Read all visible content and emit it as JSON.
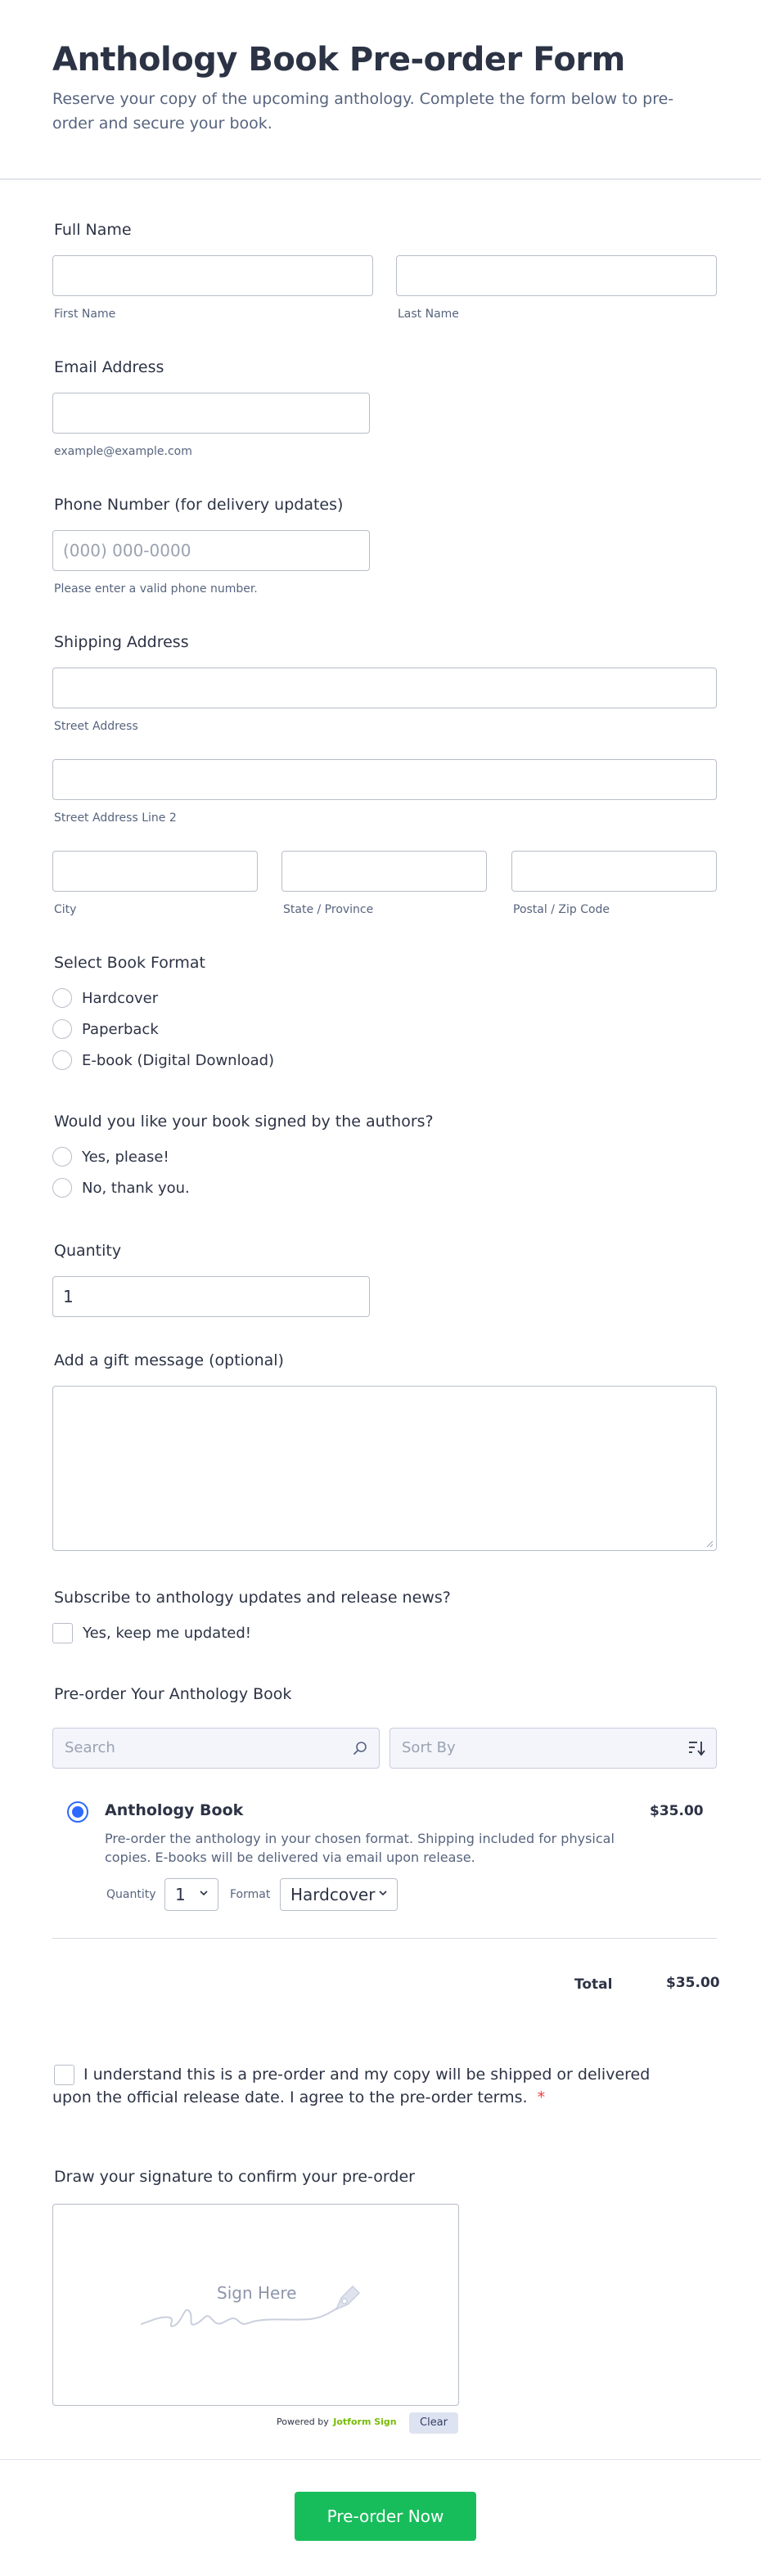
{
  "form": {
    "title": "Anthology Book Pre-order Form",
    "subtitle": "Reserve your copy of the upcoming anthology. Complete the form below to pre-order and secure your book."
  },
  "full_name": {
    "label": "Full Name",
    "first_sublabel": "First Name",
    "last_sublabel": "Last Name"
  },
  "email": {
    "label": "Email Address",
    "sublabel": "example@example.com"
  },
  "phone": {
    "label": "Phone Number (for delivery updates)",
    "placeholder": "(000) 000-0000",
    "sublabel": "Please enter a valid phone number."
  },
  "address": {
    "label": "Shipping Address",
    "street_sublabel": "Street Address",
    "street2_sublabel": "Street Address Line 2",
    "city_sublabel": "City",
    "state_sublabel": "State / Province",
    "zip_sublabel": "Postal / Zip Code"
  },
  "format": {
    "label": "Select Book Format",
    "options": [
      "Hardcover",
      "Paperback",
      "E-book (Digital Download)"
    ]
  },
  "signed": {
    "label": "Would you like your book signed by the authors?",
    "options": [
      "Yes, please!",
      "No, thank you."
    ]
  },
  "quantity": {
    "label": "Quantity",
    "value": "1"
  },
  "gift": {
    "label": "Add a gift message (optional)"
  },
  "subscribe": {
    "label": "Subscribe to anthology updates and release news?",
    "option": "Yes, keep me updated!"
  },
  "product_list": {
    "label": "Pre-order Your Anthology Book",
    "search_placeholder": "Search",
    "sort_placeholder": "Sort By",
    "product": {
      "name": "Anthology Book",
      "price": "$35.00",
      "description": "Pre-order the anthology in your chosen format. Shipping included for physical copies. E-books will be delivered via email upon release.",
      "quantity_label": "Quantity",
      "quantity_value": "1",
      "format_label": "Format",
      "format_value": "Hardcover"
    },
    "total_label": "Total",
    "total_value": "$35.00"
  },
  "terms": {
    "text": "I understand this is a pre-order and my copy will be shipped or delivered upon the official release date. I agree to the pre-order terms.",
    "required_mark": "*"
  },
  "signature": {
    "label": "Draw your signature to confirm your pre-order",
    "placeholder": "Sign Here",
    "powered_by": "Powered by",
    "brand": "Jotform Sign",
    "clear_label": "Clear"
  },
  "submit": {
    "label": "Pre-order Now"
  },
  "colors": {
    "accent": "#2e69ff",
    "submit": "#18bd5b",
    "text": "#2c3345",
    "muted": "#57647e",
    "required": "#f23a3c"
  },
  "icons": [
    "search-icon",
    "sort-icon",
    "chevron-down-icon",
    "pen-icon",
    "resize-handle-icon"
  ]
}
